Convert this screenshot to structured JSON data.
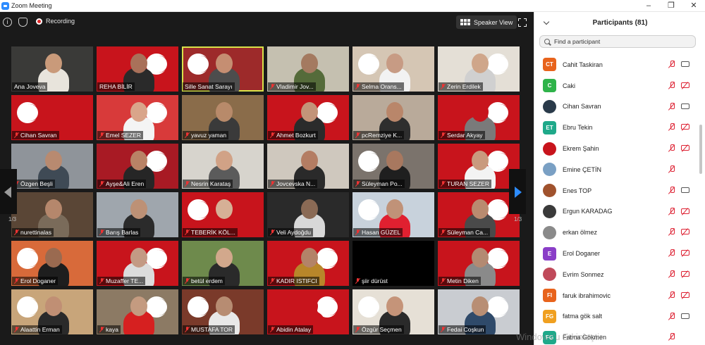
{
  "window": {
    "title": "Zoom Meeting",
    "controls": [
      "–",
      "❐",
      "✕"
    ]
  },
  "meeting": {
    "recording_label": "Recording",
    "view_button": "Speaker View",
    "page_left": "1/3",
    "page_right": "1/3",
    "tiles": [
      {
        "name": "Ana Joveva",
        "muted": false,
        "bg": "#3a3a38",
        "flag": false,
        "skin": "#c99a7a",
        "shirt": "#e8e4dc"
      },
      {
        "name": "REHA BİLİR",
        "muted": false,
        "bg": "#c8141c",
        "flag": true,
        "skin": "#a9715a",
        "shirt": "#2a2a2a"
      },
      {
        "name": "Sille Sanat Sarayı",
        "muted": false,
        "bg": "#9d2a2a",
        "flag": true,
        "skin": "#c58e72",
        "shirt": "#4d4d4d",
        "active": true
      },
      {
        "name": "Vladimir Jov...",
        "muted": true,
        "bg": "#c5c0b0",
        "flag": false,
        "skin": "#a47a60",
        "shirt": "#556b3a"
      },
      {
        "name": "Selma Orans...",
        "muted": true,
        "bg": "#d5c6b4",
        "flag": true,
        "skin": "#c79b84",
        "shirt": "#f2f2f2"
      },
      {
        "name": "Zerin Erdilek",
        "muted": true,
        "bg": "#e4dfd6",
        "flag": true,
        "skin": "#cfa68a",
        "shirt": "#d0d0d0"
      },
      {
        "name": "Cihan Savran",
        "muted": true,
        "bg": "#c8141c",
        "flag": true,
        "skin": "#c8141c",
        "shirt": "#c8141c"
      },
      {
        "name": "Emel SEZER",
        "muted": true,
        "bg": "#d83a3a",
        "flag": true,
        "skin": "#d9a58a",
        "shirt": "#f4f4f4"
      },
      {
        "name": "yavuz yaman",
        "muted": true,
        "bg": "#8a6c4a",
        "flag": false,
        "skin": "#b88a6a",
        "shirt": "#3a3a3a"
      },
      {
        "name": "Ahmet Bozkurt",
        "muted": true,
        "bg": "#c8141c",
        "flag": true,
        "skin": "#c39479",
        "shirt": "#2b2b2b"
      },
      {
        "name": "pcRemziye K...",
        "muted": true,
        "bg": "#b9aa9a",
        "flag": false,
        "skin": "#b9866a",
        "shirt": "#2e2e2e"
      },
      {
        "name": "Serdar Akyay",
        "muted": true,
        "bg": "#c8141c",
        "flag": true,
        "skin": "#c8141c",
        "shirt": "#7a7a7a"
      },
      {
        "name": "Özgen Beşli",
        "muted": true,
        "bg": "#8f949a",
        "flag": false,
        "skin": "#b88a70",
        "shirt": "#3f4a55"
      },
      {
        "name": "Ayşe&Ali Eren",
        "muted": true,
        "bg": "#a81a24",
        "flag": true,
        "skin": "#b98366",
        "shirt": "#262626"
      },
      {
        "name": "Nesrin Karataş",
        "muted": true,
        "bg": "#d7d4cd",
        "flag": false,
        "skin": "#d1a286",
        "shirt": "#5b5b5b"
      },
      {
        "name": "Jovcevska N...",
        "muted": true,
        "bg": "#cfc8be",
        "flag": false,
        "skin": "#b47d63",
        "shirt": "#2a2a2a"
      },
      {
        "name": "Süleyman Po...",
        "muted": true,
        "bg": "#7b736c",
        "flag": true,
        "skin": "#a8785f",
        "shirt": "#1f1f1f"
      },
      {
        "name": "TURAN SEZER",
        "muted": true,
        "bg": "#c8141c",
        "flag": true,
        "skin": "#c99a7e",
        "shirt": "#f3f3f3"
      },
      {
        "name": "nurettinalas",
        "muted": true,
        "bg": "#5a4636",
        "flag": false,
        "skin": "#b5876c",
        "shirt": "#7a6b5a"
      },
      {
        "name": "Barış Barlas",
        "muted": true,
        "bg": "#9fa6ad",
        "flag": false,
        "skin": "#bd9176",
        "shirt": "#2b2b2b"
      },
      {
        "name": "TEBERİK KÖL...",
        "muted": true,
        "bg": "#c8141c",
        "flag": true,
        "skin": "#d6b096",
        "shirt": "#c8141c"
      },
      {
        "name": "Veli Aydoğdu",
        "muted": true,
        "bg": "#2a2a2a",
        "flag": false,
        "skin": "#8a6a55",
        "shirt": "#d8d8d8"
      },
      {
        "name": "Hasan GÜZEL",
        "muted": true,
        "bg": "#c8d2dc",
        "flag": true,
        "skin": "#c09278",
        "shirt": "#e02030"
      },
      {
        "name": "Süleyman Ca...",
        "muted": true,
        "bg": "#c8141c",
        "flag": true,
        "skin": "#b98b70",
        "shirt": "#4a4a4a"
      },
      {
        "name": "Erol Doganer",
        "muted": true,
        "bg": "#d86a3a",
        "flag": true,
        "skin": "#9a6a50",
        "shirt": "#1e1e1e"
      },
      {
        "name": "Muzaffer TE...",
        "muted": true,
        "bg": "#c8141c",
        "flag": true,
        "skin": "#c39a84",
        "shirt": "#dcdcdc"
      },
      {
        "name": "betül erdem",
        "muted": true,
        "bg": "#6e8a4c",
        "flag": false,
        "skin": "#d2a88c",
        "shirt": "#2a2a2a"
      },
      {
        "name": "KADIR ISTIFCI",
        "muted": true,
        "bg": "#c8141c",
        "flag": true,
        "skin": "#b38368",
        "shirt": "#b8862a"
      },
      {
        "name": "şiir dürüst",
        "muted": true,
        "bg": "#000000",
        "flag": false,
        "skin": "#000000",
        "shirt": "#000000"
      },
      {
        "name": "Metin Diken",
        "muted": true,
        "bg": "#c8141c",
        "flag": true,
        "skin": "#b38a72",
        "shirt": "#8a8a8a"
      },
      {
        "name": "Alaattin Erman",
        "muted": true,
        "bg": "#c8a57a",
        "flag": true,
        "skin": "#c08f74",
        "shirt": "#2a2a2a"
      },
      {
        "name": "kaya",
        "muted": true,
        "bg": "#8c7a64",
        "flag": true,
        "skin": "#c49b80",
        "shirt": "#d62020"
      },
      {
        "name": "MUSTAFA TOR",
        "muted": true,
        "bg": "#7a3a2a",
        "flag": true,
        "skin": "#b78c72",
        "shirt": "#e8e8e8"
      },
      {
        "name": "Abidin Atalay",
        "muted": true,
        "bg": "#c8141c",
        "flag": true,
        "skin": "#c8141c",
        "shirt": "#c8141c"
      },
      {
        "name": "Özgür Seçmen",
        "muted": true,
        "bg": "#e6e0d6",
        "flag": true,
        "skin": "#c59479",
        "shirt": "#2a2a2a"
      },
      {
        "name": "Fedai Coşkun",
        "muted": true,
        "bg": "#c9ccd1",
        "flag": true,
        "skin": "#b88e74",
        "shirt": "#2f4a6a"
      }
    ]
  },
  "participants": {
    "title": "Participants (81)",
    "search_placeholder": "Find a participant",
    "list": [
      {
        "name": "Cahit Taskiran",
        "initials": "CT",
        "color": "#e8631c",
        "cam_off": false
      },
      {
        "name": "Caki",
        "initials": "C",
        "color": "#2fb34a",
        "cam_off": true
      },
      {
        "name": "Cihan Savran",
        "initials": "",
        "color": "#2a3a4a",
        "cam_off": false
      },
      {
        "name": "Ebru Tekin",
        "initials": "ET",
        "color": "#1fa98a",
        "cam_off": true
      },
      {
        "name": "Ekrem Şahin",
        "initials": "",
        "color": "#c8141c",
        "cam_off": true
      },
      {
        "name": "Emine ÇETİN",
        "initials": "",
        "color": "#7aa0c4",
        "cam_off": false,
        "no_cam": true
      },
      {
        "name": "Enes TOP",
        "initials": "",
        "color": "#a0522d",
        "cam_off": false
      },
      {
        "name": "Ergun KARADAG",
        "initials": "",
        "color": "#3a3a3a",
        "cam_off": true
      },
      {
        "name": "erkan ölmez",
        "initials": "",
        "color": "#8a8a8a",
        "cam_off": true
      },
      {
        "name": "Erol Doganer",
        "initials": "E",
        "color": "#8a3ec8",
        "cam_off": true
      },
      {
        "name": "Evrim Sonmez",
        "initials": "",
        "color": "#c04a5a",
        "cam_off": true
      },
      {
        "name": "faruk ibrahimovic",
        "initials": "FI",
        "color": "#e8631c",
        "cam_off": true
      },
      {
        "name": "fatma gök salt",
        "initials": "FG",
        "color": "#f0a020",
        "cam_off": false
      },
      {
        "name": "Fatma Gökmen",
        "initials": "FG",
        "color": "#1fa98a",
        "cam_off": false,
        "no_cam": true
      }
    ]
  },
  "watermark": "Windows'u Etkinleştir"
}
